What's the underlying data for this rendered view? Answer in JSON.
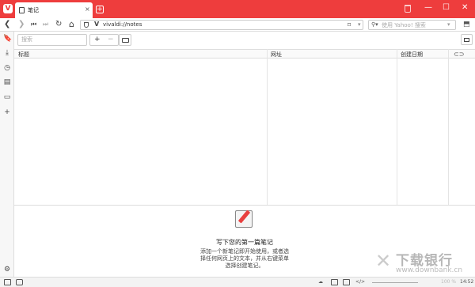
{
  "browser": {
    "logo": "V",
    "tab": {
      "title": "笔记",
      "close": "×"
    },
    "new_tab": "+",
    "window_controls": {
      "minimize": "—",
      "maximize": "☐",
      "close": "✕"
    }
  },
  "address_bar": {
    "back": "❮",
    "forward": "❯",
    "rewind": "⏮",
    "fast_forward": "⏭",
    "reload": "↻",
    "home": "⌂",
    "url": "vivaldi://notes",
    "search_placeholder": "使用 Yahoo! 搜索"
  },
  "sidebar": {
    "items": [
      {
        "icon": "bookmark-icon",
        "glyph": "🔖"
      },
      {
        "icon": "download-icon",
        "glyph": "⤓"
      },
      {
        "icon": "history-icon",
        "glyph": "◷"
      },
      {
        "icon": "notes-icon",
        "glyph": "▤"
      },
      {
        "icon": "window-icon",
        "glyph": "▭"
      },
      {
        "icon": "add-panel-icon",
        "glyph": "+"
      }
    ],
    "settings_glyph": "⚙"
  },
  "notes": {
    "search_placeholder": "搜索",
    "add_label": "+",
    "remove_label": "−",
    "columns": {
      "title": "标题",
      "url": "网址",
      "created": "创建日期"
    },
    "empty_title": "写下您的第一篇笔记",
    "empty_description": "添加一个新笔记即开始使用，或者选择任何网页上的文本，并从右键菜单选择创建笔记。"
  },
  "status": {
    "zoom": "100 %",
    "time": "14:52"
  },
  "watermark": {
    "cn": "下载银行",
    "en": "www.downbank.cn"
  }
}
